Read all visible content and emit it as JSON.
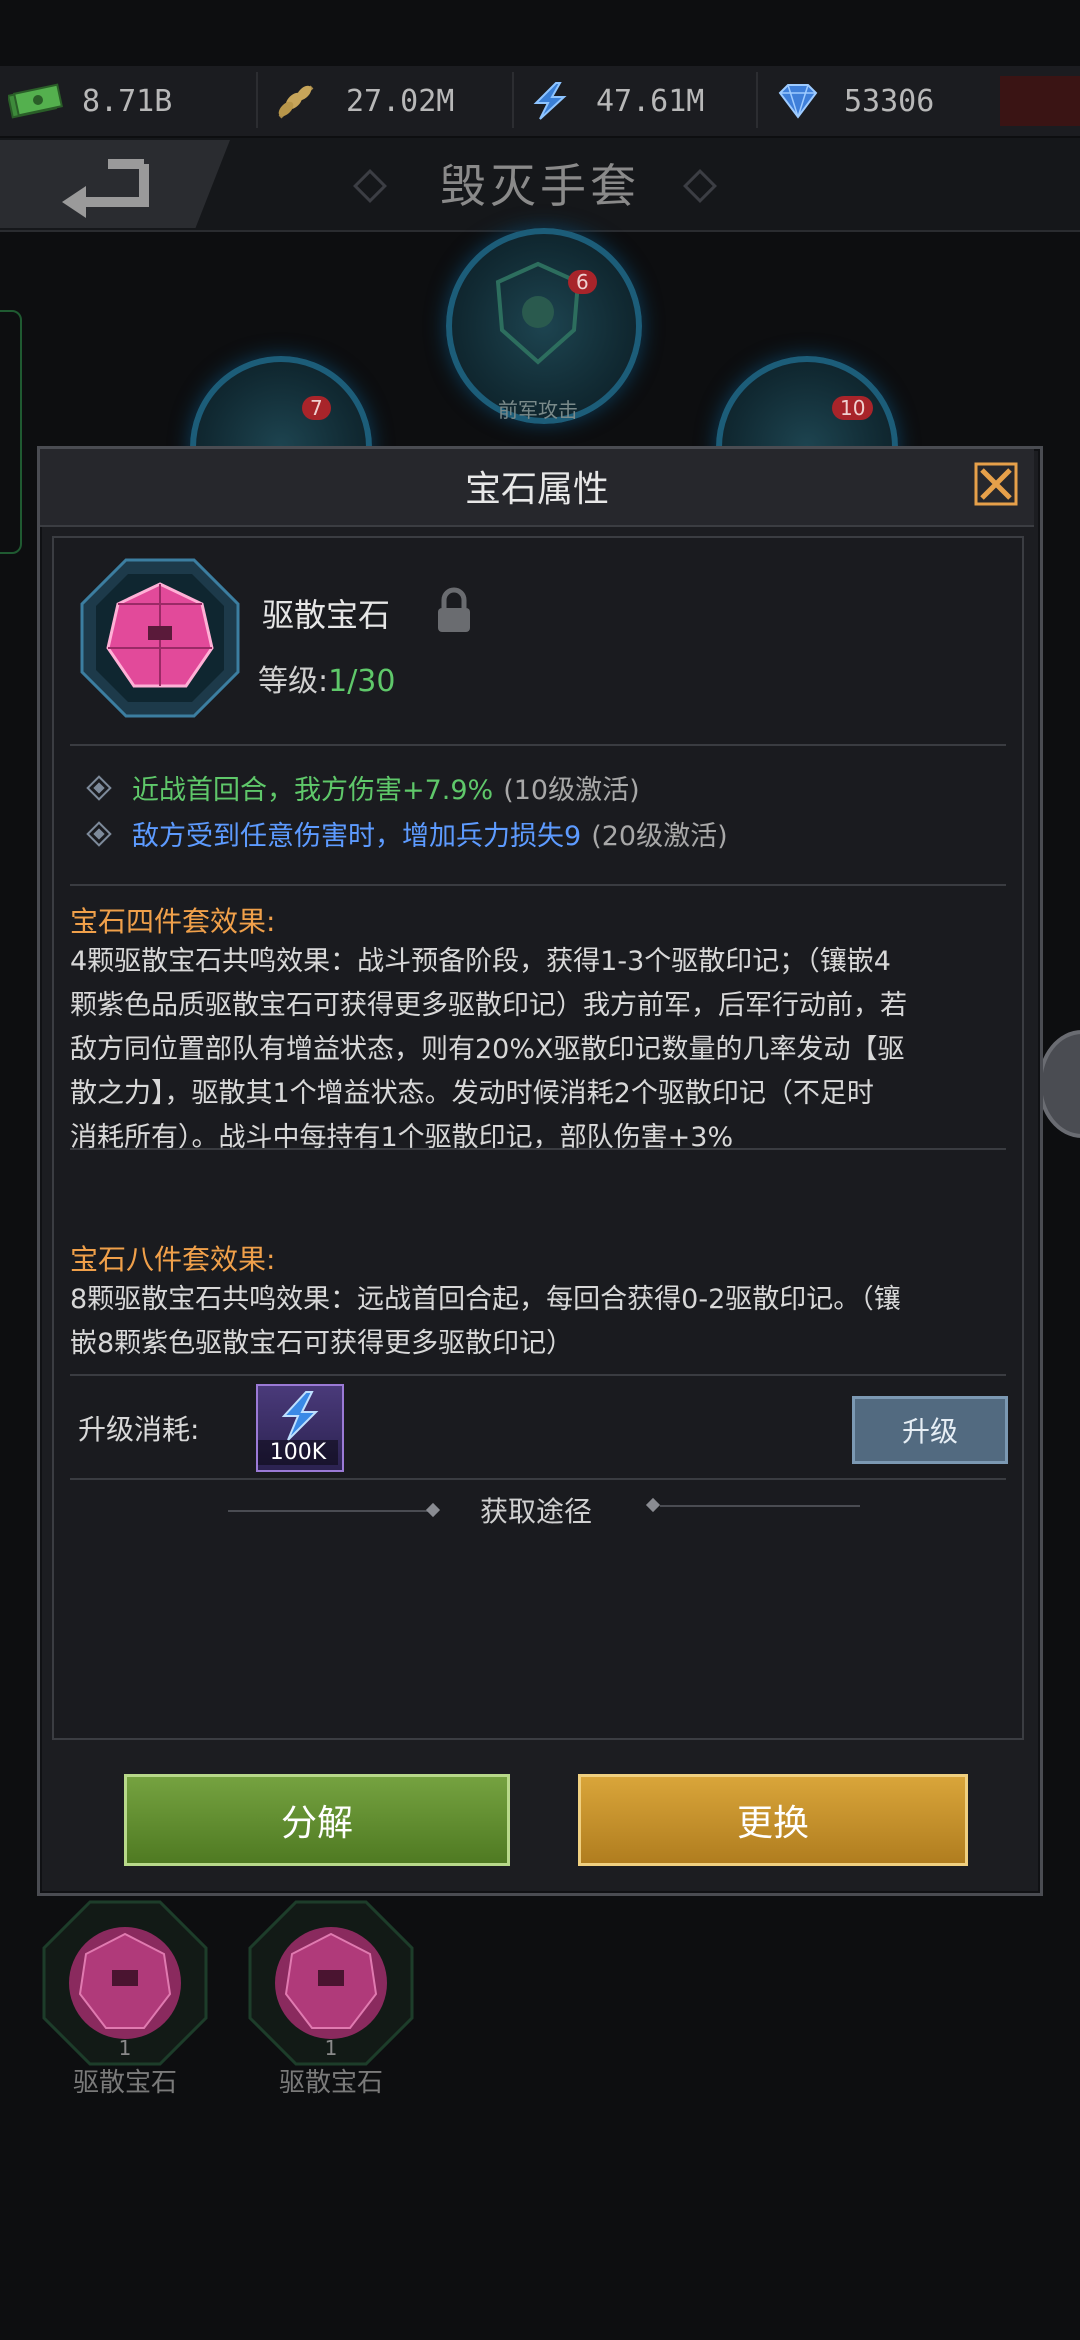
{
  "resources": [
    {
      "icon": "money-icon",
      "value": "8.71B"
    },
    {
      "icon": "wheat-icon",
      "value": "27.02M"
    },
    {
      "icon": "lightning-icon",
      "value": "47.61M"
    },
    {
      "icon": "diamond-icon",
      "value": "53306"
    }
  ],
  "header": {
    "title": "毁灭手套"
  },
  "background_nodes": [
    {
      "badge": "7"
    },
    {
      "badge": "6",
      "caption": "前军攻击"
    },
    {
      "badge": "10"
    }
  ],
  "modal": {
    "title": "宝石属性",
    "gem": {
      "name": "驱散宝石",
      "level_label": "等级:",
      "level_value": "1/30"
    },
    "attributes": [
      {
        "text": "近战首回合，我方伤害+7.9%",
        "note": "(10级激活)",
        "color": "#5fc86a"
      },
      {
        "text": "敌方受到任意伤害时，增加兵力损失9",
        "note": "(20级激活)",
        "color": "#5d9bff"
      }
    ],
    "set4": {
      "title": "宝石四件套效果:",
      "lines": [
        "4颗驱散宝石共鸣效果：战斗预备阶段，获得1-3个驱散印记；（镶嵌4",
        "颗紫色品质驱散宝石可获得更多驱散印记）我方前军，后军行动前，若",
        "敌方同位置部队有增益状态，则有20%X驱散印记数量的几率发动【驱",
        "散之力】，驱散其1个增益状态。发动时候消耗2个驱散印记（不足时",
        "消耗所有）。战斗中每持有1个驱散印记，部队伤害+3%"
      ]
    },
    "set8": {
      "title": "宝石八件套效果:",
      "lines": [
        "8颗驱散宝石共鸣效果：远战首回合起，每回合获得0-2驱散印记。（镶",
        "嵌8颗紫色驱散宝石可获得更多驱散印记）"
      ]
    },
    "upgrade": {
      "cost_label": "升级消耗:",
      "cost_qty": "100K",
      "button": "升级"
    },
    "get_path": "获取途径",
    "decompose_button": "分解",
    "replace_button": "更换"
  },
  "inventory": [
    {
      "name": "驱散宝石",
      "qty": "1"
    },
    {
      "name": "驱散宝石",
      "qty": "1"
    }
  ],
  "colors": {
    "accent_orange": "#f0a04a",
    "green": "#5fc86a",
    "blue": "#5d9bff"
  }
}
